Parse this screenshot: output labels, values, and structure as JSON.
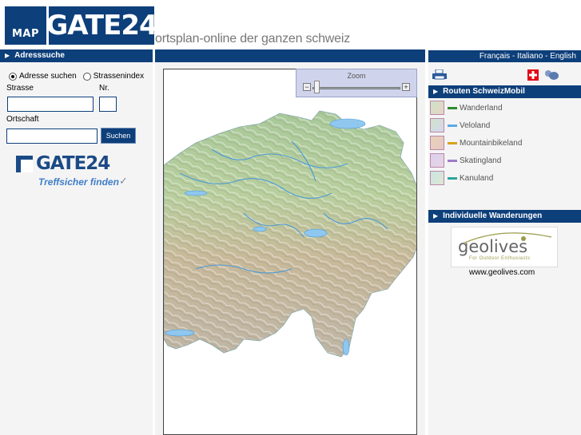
{
  "header": {
    "logo_map": "MAP",
    "logo_gate": "GATE24",
    "tagline": "ortsplan-online der ganzen schweiz"
  },
  "left": {
    "section_title": "Adresssuche",
    "radio_address": "Adresse suchen",
    "radio_index": "Strassenindex",
    "street_label": "Strasse",
    "number_label": "Nr.",
    "city_label": "Ortschaft",
    "street_value": "",
    "number_value": "",
    "city_value": "",
    "search_button": "Suchen",
    "brand": "GATE24",
    "brand_tagline": "Treffsicher finden"
  },
  "map": {
    "zoom_label": "Zoom",
    "zoom_minus": "−",
    "zoom_plus": "+"
  },
  "right": {
    "languages": "Français - Italiano - English",
    "routes_title": "Routen SchweizMobil",
    "routes": [
      {
        "label": "Wanderland",
        "color": "#2e8b2e"
      },
      {
        "label": "Veloland",
        "color": "#5aa9e6"
      },
      {
        "label": "Mountainbikeland",
        "color": "#d9a21a"
      },
      {
        "label": "Skatingland",
        "color": "#a07bc8"
      },
      {
        "label": "Kanuland",
        "color": "#2aa59a"
      }
    ],
    "individual_title": "Individuelle Wanderungen",
    "geolives_logo": "geolives",
    "geolives_tagline": "For Outdoor Enthusiasts",
    "geolives_url": "www.geolives.com"
  },
  "colors": {
    "brand_blue": "#0d3f7a",
    "swiss_red": "#e30613"
  }
}
